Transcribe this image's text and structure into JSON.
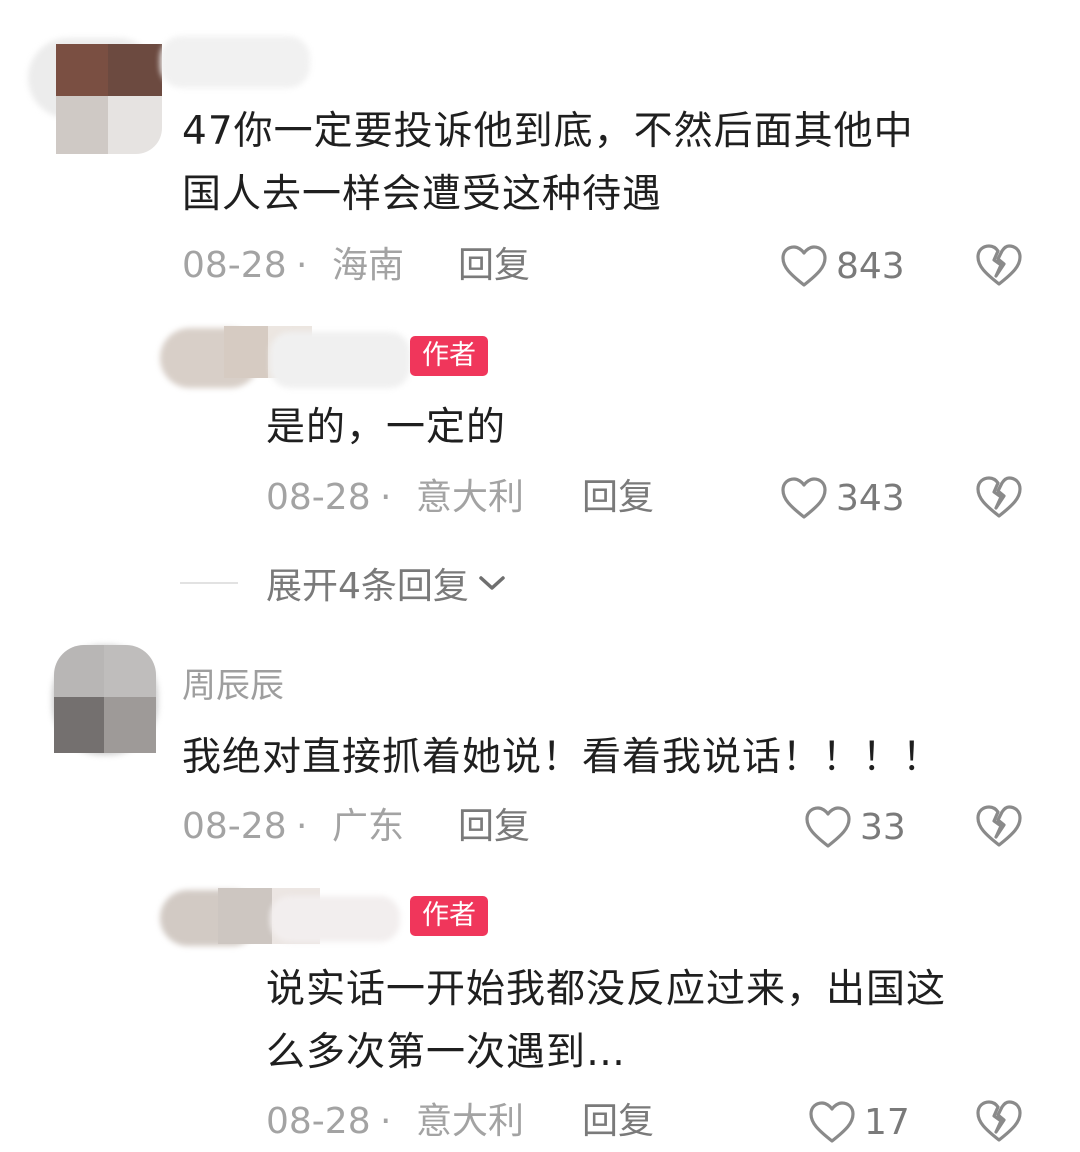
{
  "comments": [
    {
      "username": "",
      "text_lines": [
        "47你一定要投诉他到底，不然后面其他中",
        "国人去一样会遭受这种待遇"
      ],
      "date": "08-28",
      "separator": "·",
      "location": "海南",
      "reply_label": "回复",
      "likes": "843",
      "replies": [
        {
          "username": "",
          "badge": "作者",
          "text_lines": [
            "是的，一定的"
          ],
          "date": "08-28",
          "separator": "·",
          "location": "意大利",
          "reply_label": "回复",
          "likes": "343"
        }
      ],
      "expand_label": "展开4条回复"
    },
    {
      "username": "周辰辰",
      "text_lines": [
        "我绝对直接抓着她说！看着我说话！！！！"
      ],
      "date": "08-28",
      "separator": "·",
      "location": "广东",
      "reply_label": "回复",
      "likes": "33",
      "replies": [
        {
          "username": "",
          "badge": "作者",
          "text_lines": [
            "说实话一开始我都没反应过来，出国这",
            "么多次第一次遇到…"
          ],
          "date": "08-28",
          "separator": "·",
          "location": "意大利",
          "reply_label": "回复",
          "likes": "17"
        }
      ]
    }
  ],
  "icons": {
    "like": "heart-outline-icon",
    "dislike": "broken-heart-icon",
    "expand": "chevron-down-icon"
  },
  "colors": {
    "badge": "#f0365b",
    "text": "#1f1f1f",
    "meta": "#a3a3a3"
  }
}
